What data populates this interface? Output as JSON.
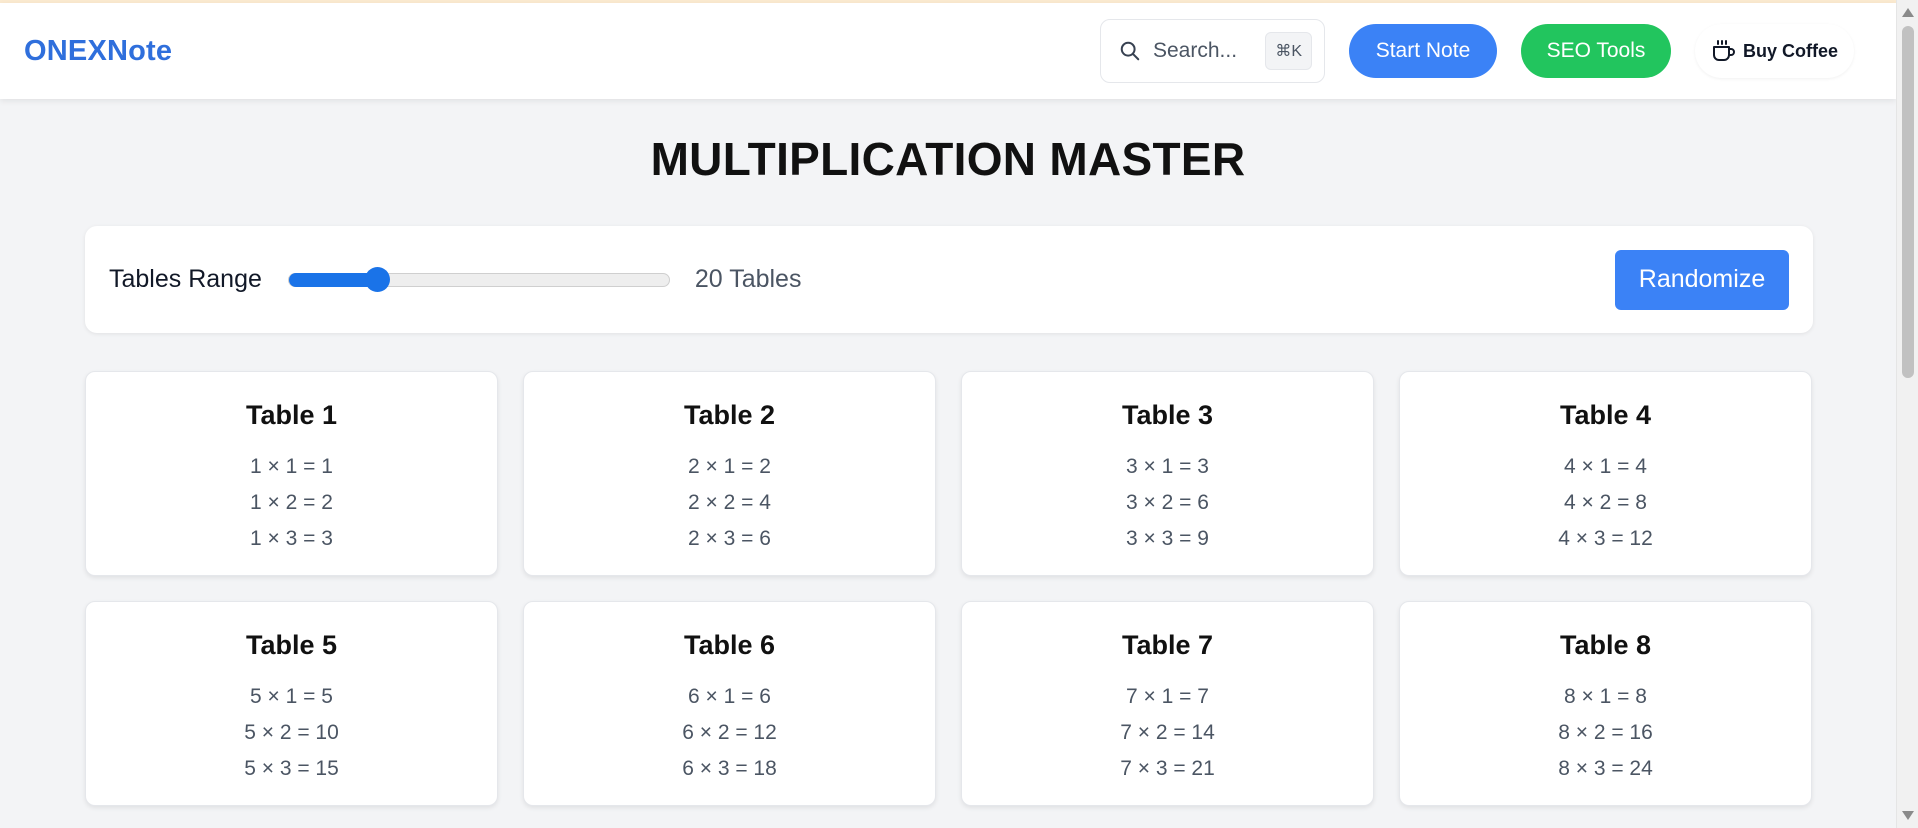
{
  "header": {
    "brand": "ONEXNote",
    "search_placeholder": "Search...",
    "search_shortcut": "⌘K",
    "start_note": "Start Note",
    "seo_tools": "SEO Tools",
    "buy_coffee": "Buy Coffee"
  },
  "page": {
    "title": "MULTIPLICATION MASTER"
  },
  "controls": {
    "range_label": "Tables Range",
    "range_value": "20 Tables",
    "slider_fraction": 0.2,
    "randomize_label": "Randomize"
  },
  "tables": [
    {
      "title": "Table 1",
      "rows": [
        "1 × 1 = 1",
        "1 × 2 = 2",
        "1 × 3 = 3"
      ]
    },
    {
      "title": "Table 2",
      "rows": [
        "2 × 1 = 2",
        "2 × 2 = 4",
        "2 × 3 = 6"
      ]
    },
    {
      "title": "Table 3",
      "rows": [
        "3 × 1 = 3",
        "3 × 2 = 6",
        "3 × 3 = 9"
      ]
    },
    {
      "title": "Table 4",
      "rows": [
        "4 × 1 = 4",
        "4 × 2 = 8",
        "4 × 3 = 12"
      ]
    },
    {
      "title": "Table 5",
      "rows": [
        "5 × 1 = 5",
        "5 × 2 = 10",
        "5 × 3 = 15"
      ]
    },
    {
      "title": "Table 6",
      "rows": [
        "6 × 1 = 6",
        "6 × 2 = 12",
        "6 × 3 = 18"
      ]
    },
    {
      "title": "Table 7",
      "rows": [
        "7 × 1 = 7",
        "7 × 2 = 14",
        "7 × 3 = 21"
      ]
    },
    {
      "title": "Table 8",
      "rows": [
        "8 × 1 = 8",
        "8 × 2 = 16",
        "8 × 3 = 24"
      ]
    }
  ],
  "colors": {
    "brand": "#2f6fdc",
    "primary": "#3b82f6",
    "success": "#22c55e",
    "slider": "#1a73e8"
  }
}
